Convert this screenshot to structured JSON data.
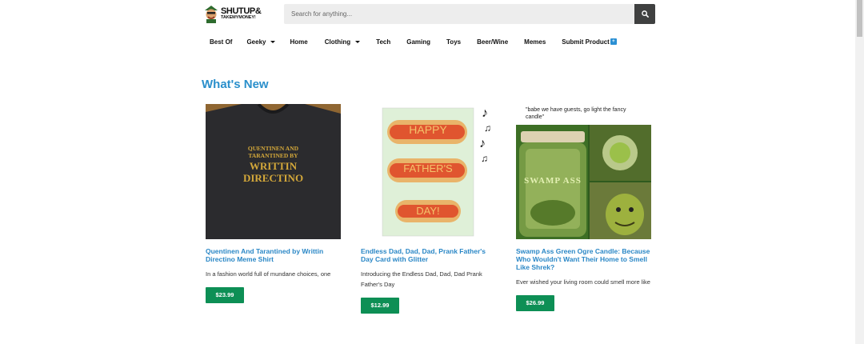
{
  "header": {
    "logo_main": "SHUTUP&",
    "logo_sub": "TAKEMYMONEY!",
    "search_placeholder": "Search for anything..."
  },
  "nav": {
    "items": [
      {
        "label": "Best Of"
      },
      {
        "label": "Geeky"
      },
      {
        "label": "Home"
      },
      {
        "label": "Clothing"
      },
      {
        "label": "Tech"
      },
      {
        "label": "Gaming"
      },
      {
        "label": "Toys"
      },
      {
        "label": "Beer/Wine"
      },
      {
        "label": "Memes"
      },
      {
        "label": "Submit Product"
      }
    ]
  },
  "main": {
    "section_title": "What's New",
    "products": [
      {
        "title": "Quentinen And Tarantined by Writtin Directino Meme Shirt",
        "description": "In a fashion world full of mundane choices, one",
        "price": "$23.99",
        "image_text": [
          "QUENTINEN AND",
          "TARANTINED BY",
          "WRITTIN",
          "DIRECTINO"
        ]
      },
      {
        "title": "Endless Dad, Dad, Dad, Prank Father's Day Card with Glitter",
        "description": "Introducing the Endless Dad, Dad, Dad Prank Father's Day",
        "price": "$12.99",
        "image_text": [
          "HAPPY",
          "FATHER'S",
          "DAY!"
        ]
      },
      {
        "title": "Swamp Ass Green Ogre Candle: Because Who Wouldn't Want Their Home to Smell Like Shrek?",
        "description": "Ever wished your living room could smell more like",
        "price": "$26.99",
        "image_text": [
          "\"babe we have guests, go light the fancy candle\"",
          "SWAMP ASS"
        ]
      }
    ]
  },
  "colors": {
    "accent": "#2a8fcb",
    "price_button": "#0d8f55",
    "search_button": "#3f4040"
  }
}
